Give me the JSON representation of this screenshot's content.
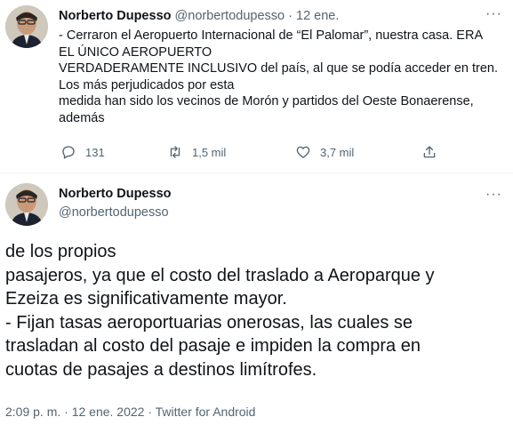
{
  "tweet1": {
    "author_name": "Norberto Dupesso",
    "handle": "@norbertodupesso",
    "separator": "·",
    "date": "12 ene.",
    "more_label": "···",
    "lines": [
      "- Cerraron el Aeropuerto Internacional de “El Palomar”, nuestra casa. ERA",
      "EL ÚNICO AEROPUERTO",
      "VERDADERAMENTE INCLUSIVO del país, al que se podía acceder en tren.",
      "Los más perjudicados por esta",
      "medida han sido los vecinos de Morón y partidos del Oeste Bonaerense,",
      "además"
    ],
    "reply_count": "131",
    "retweet_count": "1,5 mil",
    "like_count": "3,7 mil"
  },
  "tweet2": {
    "author_name": "Norberto Dupesso",
    "handle": "@norbertodupesso",
    "more_label": "···",
    "lines": [
      "de los propios",
      "pasajeros, ya que el costo del traslado a Aeroparque y",
      "Ezeiza es significativamente mayor.",
      "- Fijan tasas aeroportuarias onerosas, las cuales se",
      "trasladan al costo del pasaje e impiden la compra en",
      "cuotas de pasajes a destinos limítrofes."
    ],
    "meta": "2:09 p. m. · 12 ene. 2022 · Twitter for Android"
  },
  "icons": {
    "reply": "reply-icon",
    "retweet": "retweet-icon",
    "like": "heart-icon",
    "share": "share-icon"
  },
  "colors": {
    "text": "#0f1419",
    "muted": "#536471",
    "divider": "#eff3f4"
  }
}
